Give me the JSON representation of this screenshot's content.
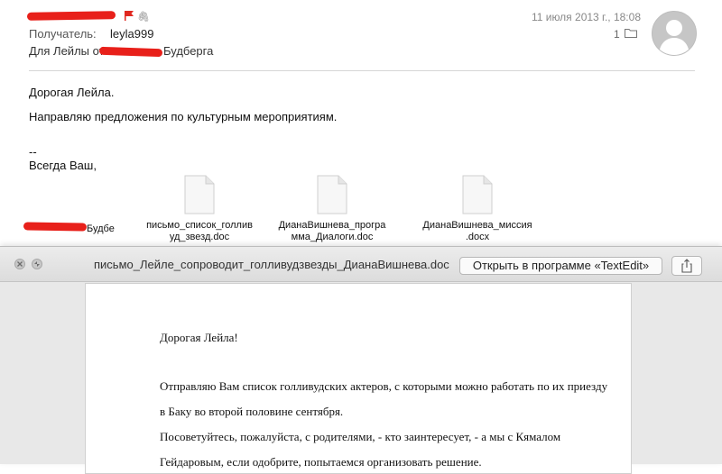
{
  "mail": {
    "to_label": "Получатель:",
    "to_value": "leyla999",
    "subject_start": "Для Лейлы от",
    "subject_end": "Будберга",
    "date": "11 июля 2013 г., 18:08",
    "attachment_count": "1",
    "body": [
      "Дорогая Лейла.",
      "Направляю предложения по культурным мероприятиям.",
      "--",
      "Всегда Ваш,"
    ],
    "signature_tail": "Будбе",
    "attachments": [
      {
        "line1": "письмо_список_голлив",
        "line2": "уд_звезд.doc"
      },
      {
        "line1": "ДианаВишнева_програ",
        "line2": "мма_Диалоги.doc"
      },
      {
        "line1": "ДианаВишнева_миссия",
        "line2": ".docx"
      }
    ],
    "colors": {
      "redaction": "#e8201a",
      "flag": "#e0271f"
    }
  },
  "quicklook": {
    "title": "письмо_Лейле_сопроводит_голливудзвезды_ДианаВишнева.doc",
    "open_button": "Открыть в программе «TextEdit»",
    "icons": [
      "close-icon",
      "fullscreen-icon",
      "share-icon"
    ],
    "doc_lines": [
      "Дорогая Лейла!",
      "Отправляю Вам список голливудских актеров, с которыми можно работать по их приезду",
      "в Баку во второй половине сентября.",
      "Посоветуйтесь, пожалуйста, с родителями, - кто заинтересует, - а мы с Кямалом",
      "Гейдаровым, если одобрите, попытаемся организовать решение."
    ]
  }
}
